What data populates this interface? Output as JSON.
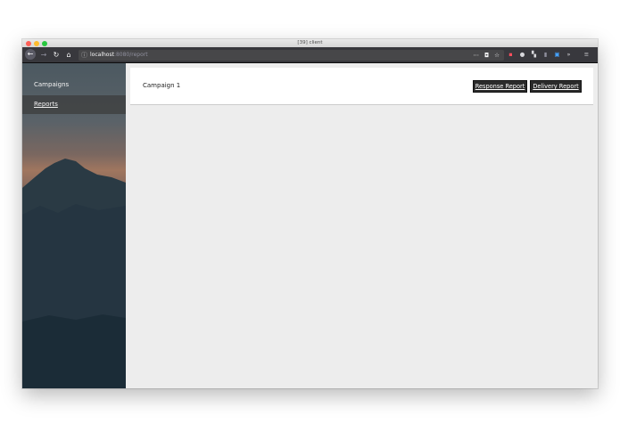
{
  "window": {
    "title": "[39] client"
  },
  "browser": {
    "url_host": "localhost",
    "url_path": ":8080/report",
    "menu_glyph": "≡",
    "overflow_glyph": "»"
  },
  "sidebar": {
    "items": [
      {
        "label": "Campaigns"
      },
      {
        "label": "Reports"
      }
    ]
  },
  "main": {
    "campaign_title": "Campaign 1",
    "buttons": {
      "response_report": "Response Report",
      "delivery_report": "Delivery Report"
    }
  },
  "colors": {
    "sidebar_active_bg": "#3c3c3c",
    "button_bg": "#2b2b2b",
    "content_bg": "#ededed"
  }
}
